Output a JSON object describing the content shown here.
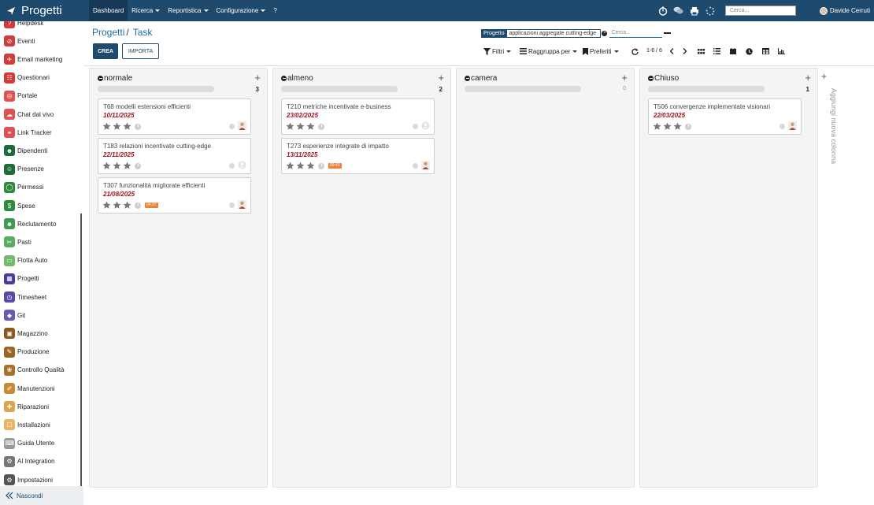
{
  "app": {
    "title": "Progetti"
  },
  "nav": {
    "menu": [
      {
        "label": "Dashboard",
        "active": true,
        "dropdown": false
      },
      {
        "label": "Ricerca",
        "active": false,
        "dropdown": true
      },
      {
        "label": "Reportistica",
        "active": false,
        "dropdown": true
      },
      {
        "label": "Configurazione",
        "active": false,
        "dropdown": true
      },
      {
        "label": "?",
        "active": false,
        "dropdown": false
      }
    ],
    "search_placeholder": "Cerca...",
    "user_name": "Davide Cerruti"
  },
  "sidebar": {
    "items": [
      {
        "label": "Helpdesk",
        "color": "#d43b3b"
      },
      {
        "label": "Eventi",
        "color": "#d43b3b"
      },
      {
        "label": "Email marketing",
        "color": "#d43b3b"
      },
      {
        "label": "Questionari",
        "color": "#d43b3b"
      },
      {
        "label": "Portale",
        "color": "#e05252"
      },
      {
        "label": "Chat dal vivo",
        "color": "#e05252"
      },
      {
        "label": "Link Tracker",
        "color": "#e05252"
      },
      {
        "label": "Dipendenti",
        "color": "#1f6b3a"
      },
      {
        "label": "Presenze",
        "color": "#1f6b3a"
      },
      {
        "label": "Permessi",
        "color": "#2e8b3e"
      },
      {
        "label": "Spese",
        "color": "#2e8b3e"
      },
      {
        "label": "Reclutamento",
        "color": "#3f9a52"
      },
      {
        "label": "Pasti",
        "color": "#5aae62"
      },
      {
        "label": "Flotta Auto",
        "color": "#6fbb6a"
      },
      {
        "label": "Progetti",
        "color": "#4a3a99"
      },
      {
        "label": "Timesheet",
        "color": "#5a48a8"
      },
      {
        "label": "Git",
        "color": "#6a58b6"
      },
      {
        "label": "Magazzino",
        "color": "#8a5a1c"
      },
      {
        "label": "Produzione",
        "color": "#9b6624"
      },
      {
        "label": "Controllo Qualità",
        "color": "#a8732c"
      },
      {
        "label": "Manutenzioni",
        "color": "#c98a35"
      },
      {
        "label": "Riparazioni",
        "color": "#e0a24a"
      },
      {
        "label": "Installazioni",
        "color": "#e8b466"
      },
      {
        "label": "Guida Utente",
        "color": "#9a9a9a"
      },
      {
        "label": "AI Integration",
        "color": "#777777"
      },
      {
        "label": "Impostazioni",
        "color": "#555555"
      }
    ],
    "hide_label": "Nascondi"
  },
  "breadcrumb": {
    "parent": "Progetti",
    "separator": "/",
    "current": "Task"
  },
  "actions": {
    "create_label": "CREA",
    "import_label": "IMPORTA"
  },
  "search": {
    "facet_label": "Progetto",
    "facet_value": "applicazioni aggregate cutting-edge",
    "placeholder": "Cerca..."
  },
  "toolbar": {
    "filters_label": "Filtri",
    "groupby_label": "Raggruppa per",
    "favorites_label": "Preferiti",
    "pager": "1-6 / 6"
  },
  "columns": [
    {
      "name": "normale",
      "count": "3",
      "cards": [
        {
          "title": "T68 modelli estensioni efficienti",
          "date": "10/11/2025",
          "badge": "",
          "avatar": true
        },
        {
          "title": "T183 relazioni incentivate cutting-edge",
          "date": "22/11/2025",
          "badge": "",
          "avatar": false
        },
        {
          "title": "T307 funzionalità migliorate efficienti",
          "date": "21/08/2025",
          "badge": "04:27",
          "avatar": true
        }
      ]
    },
    {
      "name": "almeno",
      "count": "2",
      "cards": [
        {
          "title": "T210 metriche incentivate e-business",
          "date": "23/02/2025",
          "badge": "",
          "avatar": false
        },
        {
          "title": "T273 esperienze integrate di impatto",
          "date": "13/11/2025",
          "badge": "09:43",
          "avatar": true
        }
      ]
    },
    {
      "name": "camera",
      "count": "0",
      "cards": []
    },
    {
      "name": "Chiuso",
      "count": "1",
      "cards": [
        {
          "title": "T506 convergenze implementate visionari",
          "date": "22/03/2025",
          "badge": "",
          "avatar": true
        }
      ]
    }
  ],
  "add_column_label": "Aggiungi nuova colonna",
  "colors": {
    "navbar": "#1e4a6e",
    "link": "#1e6ca8",
    "date": "#a3131b",
    "badge": "#f0813a"
  }
}
